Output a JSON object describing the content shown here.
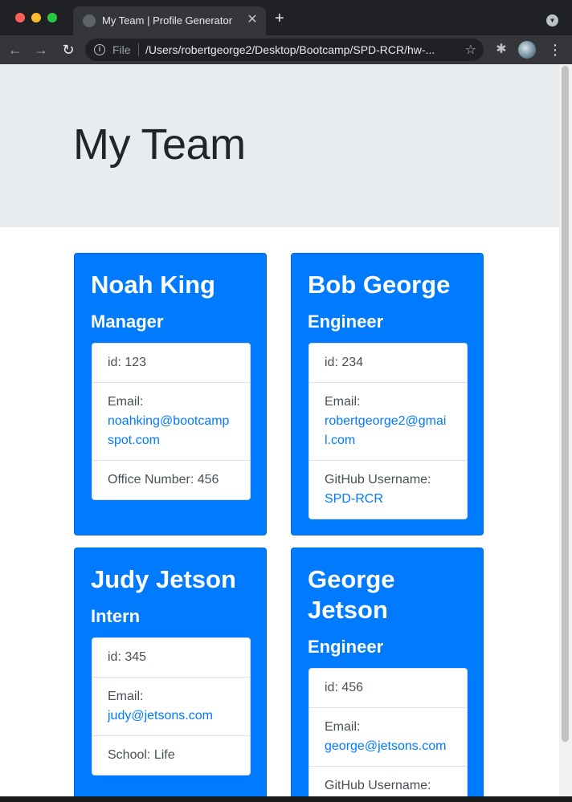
{
  "browser": {
    "tab_title": "My Team | Profile Generator",
    "tab_close": "✕",
    "new_tab": "+",
    "scheme": "File",
    "url": "/Users/robertgeorge2/Desktop/Bootcamp/SPD-RCR/hw-..."
  },
  "page": {
    "title": "My Team"
  },
  "team": [
    {
      "name": "Noah King",
      "role": "Manager",
      "id": "id: 123",
      "email_label": "Email:",
      "email": "noahking@bootcampspot.com",
      "extra_label": "Office Number: 456",
      "extra_value": ""
    },
    {
      "name": "Bob George",
      "role": "Engineer",
      "id": "id: 234",
      "email_label": "Email:",
      "email": "robertgeorge2@gmail.com",
      "extra_label": "GitHub Username:",
      "extra_value": "SPD-RCR"
    },
    {
      "name": "Judy Jetson",
      "role": "Intern",
      "id": "id: 345",
      "email_label": "Email:",
      "email": "judy@jetsons.com",
      "extra_label": "School: Life",
      "extra_value": ""
    },
    {
      "name": "George Jetson",
      "role": "Engineer",
      "id": "id: 456",
      "email_label": "Email:",
      "email": "george@jetsons.com",
      "extra_label": "GitHub Username:",
      "extra_value": ""
    }
  ]
}
